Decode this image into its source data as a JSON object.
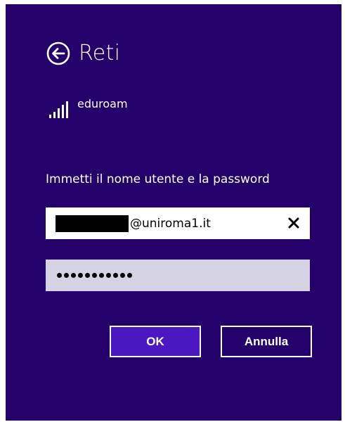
{
  "panel": {
    "title": "Reti",
    "back_icon": "arrow-left-circle-icon"
  },
  "network": {
    "icon": "wifi-signal-bars-icon",
    "name": "eduroam"
  },
  "prompt": "Immetti il nome utente e la password",
  "username": {
    "domain_suffix": "@uniroma1.it",
    "redacted": true,
    "clear_icon": "close-x-icon"
  },
  "password": {
    "masked_length": 11
  },
  "buttons": {
    "ok_label": "OK",
    "cancel_label": "Annulla"
  },
  "colors": {
    "background": "#23006a",
    "ok_fill": "#4a17c0",
    "password_fill": "#d5d2e3"
  }
}
